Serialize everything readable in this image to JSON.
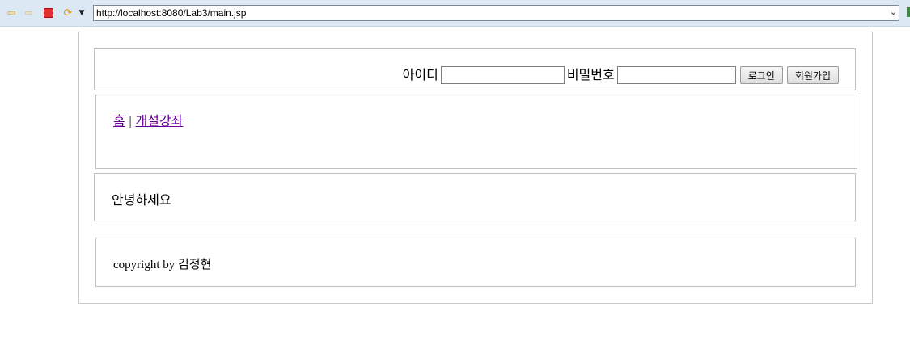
{
  "browser": {
    "url": "http://localhost:8080/Lab3/main.jsp",
    "icons": [
      "back-arrow-icon",
      "forward-arrow-icon",
      "stop-icon",
      "refresh-icon",
      "dropdown-icon"
    ]
  },
  "login": {
    "id_label": "아이디",
    "id_value": "",
    "password_label": "비밀번호",
    "password_value": "",
    "login_button": "로그인",
    "signup_button": "회원가입"
  },
  "nav": {
    "home": "홈",
    "separator": "|",
    "courses": "개설강좌"
  },
  "content": {
    "greeting": "안녕하세요"
  },
  "footer": {
    "copyright": "copyright by 김정현"
  }
}
